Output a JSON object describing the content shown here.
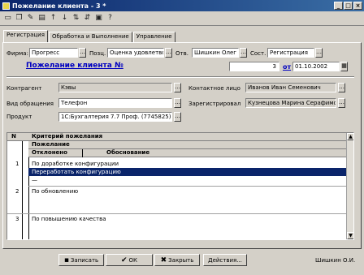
{
  "window": {
    "title": "Пожелание клиента - 3 *"
  },
  "toolbar": {
    "icons": [
      "new-icon",
      "copy-icon",
      "edit-icon",
      "print-icon",
      "up-icon",
      "down-icon",
      "sort-asc-icon",
      "sort-desc-icon",
      "help-icon",
      "question-icon"
    ]
  },
  "tabs": [
    {
      "label": "Регистрация",
      "active": true
    },
    {
      "label": "Обработка и Выполнение",
      "active": false
    },
    {
      "label": "Управление",
      "active": false
    }
  ],
  "form": {
    "firm_label": "Фирма:",
    "firm_value": "Прогресс",
    "pos_label": "Позц.",
    "pos_value": "Оценка удовлетворе",
    "otv_label": "Отв.",
    "otv_value": "Шишкин Олег И",
    "sost_label": "Сост.",
    "sost_value": "Регистрация",
    "doc_title": "Пожелание клиента №",
    "doc_number": "3",
    "from_label": "от",
    "doc_date": "01.10.2002",
    "kontragent_label": "Контрагент",
    "kontragent_value": "Кэвы",
    "kontakt_label": "Контактное лицо",
    "kontakt_value": "Иванов Иван Семенович",
    "vid_label": "Вид обращения",
    "vid_value": "Телефон",
    "zareg_label": "Зарегистрировал",
    "zareg_value": "Кузнецова Марина Серафимов",
    "product_label": "Продукт",
    "product_value": "1С:Бухгалтерия 7.7 Проф. (7745825)"
  },
  "grid": {
    "col_n": "N",
    "header1": "Критерий пожелания",
    "header2": "Пожелание",
    "header3a": "Отклонено",
    "header3b": "Обоснование",
    "rows": [
      {
        "n": "1",
        "text": "По доработке конфигурации",
        "selected": false
      },
      {
        "n": "",
        "text": "Переработать конфигурацию",
        "selected": true
      },
      {
        "n": "",
        "text": "—",
        "selected": false
      },
      {
        "n": "2",
        "text": "По обновлению",
        "selected": false
      },
      {
        "n": "3",
        "text": "По повышению качества",
        "selected": false
      }
    ]
  },
  "buttons": {
    "save": "Записать",
    "ok": "ОК",
    "close": "Закрыть",
    "add": "Действия..."
  },
  "status": {
    "author": "Шишкин О.И."
  }
}
